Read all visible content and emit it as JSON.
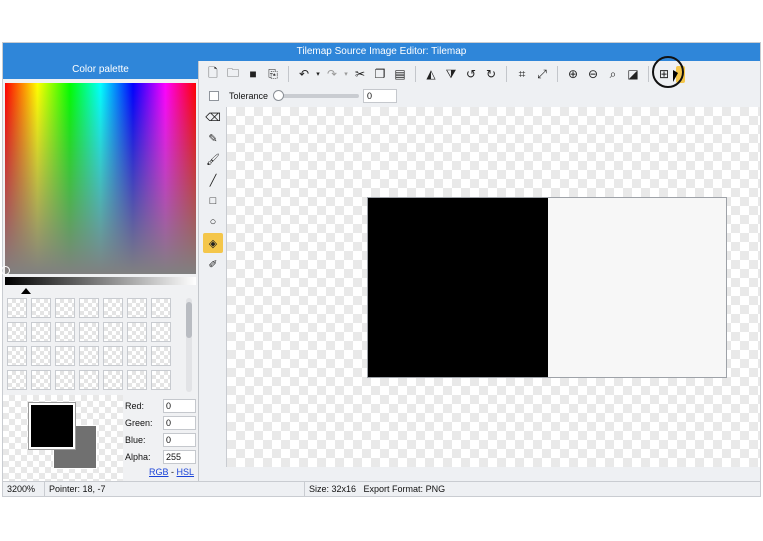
{
  "window": {
    "title": "Tilemap Source Image Editor: Tilemap"
  },
  "palette": {
    "header": "Color palette",
    "primary_color": "#000000",
    "secondary_color": "#707070",
    "fields": [
      {
        "label": "Red:",
        "value": "0"
      },
      {
        "label": "Green:",
        "value": "0"
      },
      {
        "label": "Blue:",
        "value": "0"
      },
      {
        "label": "Alpha:",
        "value": "255"
      }
    ],
    "mode_rgb": "RGB",
    "mode_sep": " - ",
    "mode_hsl": "HSL"
  },
  "toolbar": {
    "buttons": [
      "new-file-icon",
      "open-folder-icon",
      "save-icon",
      "save-as-icon",
      "undo-icon",
      "redo-icon",
      "cut-icon",
      "copy-icon",
      "paste-icon",
      "flip-horizontal-icon",
      "flip-vertical-icon",
      "rotate-left-icon",
      "rotate-right-icon",
      "crop-icon",
      "resize-icon",
      "zoom-in-icon",
      "zoom-out-icon",
      "zoom-reset-icon",
      "invert-icon",
      "grid-icon",
      "grid-options-icon"
    ]
  },
  "options": {
    "tolerance_label": "Tolerance",
    "tolerance_value": "0",
    "tolerance_fraction": 0
  },
  "tools": [
    "eraser-icon",
    "pencil-icon",
    "brush-icon",
    "line-icon",
    "rectangle-icon",
    "ellipse-icon",
    "fill-bucket-icon",
    "eyedropper-icon"
  ],
  "status": {
    "zoom": "3200%",
    "pointer": "Pointer: 18, -7",
    "size": "Size: 32x16",
    "export_format": "Export Format: PNG"
  },
  "accent_color": "#2f86d9",
  "active_tool_color": "#f4c64a"
}
